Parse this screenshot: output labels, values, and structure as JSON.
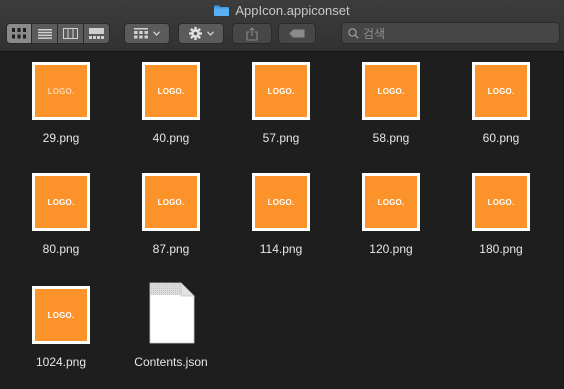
{
  "window": {
    "title": "AppIcon.appiconset"
  },
  "toolbar": {
    "view_buttons": [
      {
        "name": "icon-view",
        "active": true
      },
      {
        "name": "list-view",
        "active": false
      },
      {
        "name": "column-view",
        "active": false
      },
      {
        "name": "gallery-view",
        "active": false
      }
    ],
    "search_placeholder": "검색"
  },
  "files": [
    {
      "name": "29.png",
      "thumb_label": "LOGO."
    },
    {
      "name": "40.png",
      "thumb_label": "LOGO."
    },
    {
      "name": "57.png",
      "thumb_label": "LOGO."
    },
    {
      "name": "58.png",
      "thumb_label": "LOGO."
    },
    {
      "name": "60.png",
      "thumb_label": "LOGO."
    },
    {
      "name": "80.png",
      "thumb_label": "LOGO."
    },
    {
      "name": "87.png",
      "thumb_label": "LOGO."
    },
    {
      "name": "114.png",
      "thumb_label": "LOGO."
    },
    {
      "name": "120.png",
      "thumb_label": "LOGO."
    },
    {
      "name": "180.png",
      "thumb_label": "LOGO."
    },
    {
      "name": "1024.png",
      "thumb_label": "LOGO."
    },
    {
      "name": "Contents.json"
    }
  ],
  "colors": {
    "thumb_orange": "#fb922a",
    "folder_blue": "#3d9ae8",
    "background": "#1e1e1e"
  }
}
